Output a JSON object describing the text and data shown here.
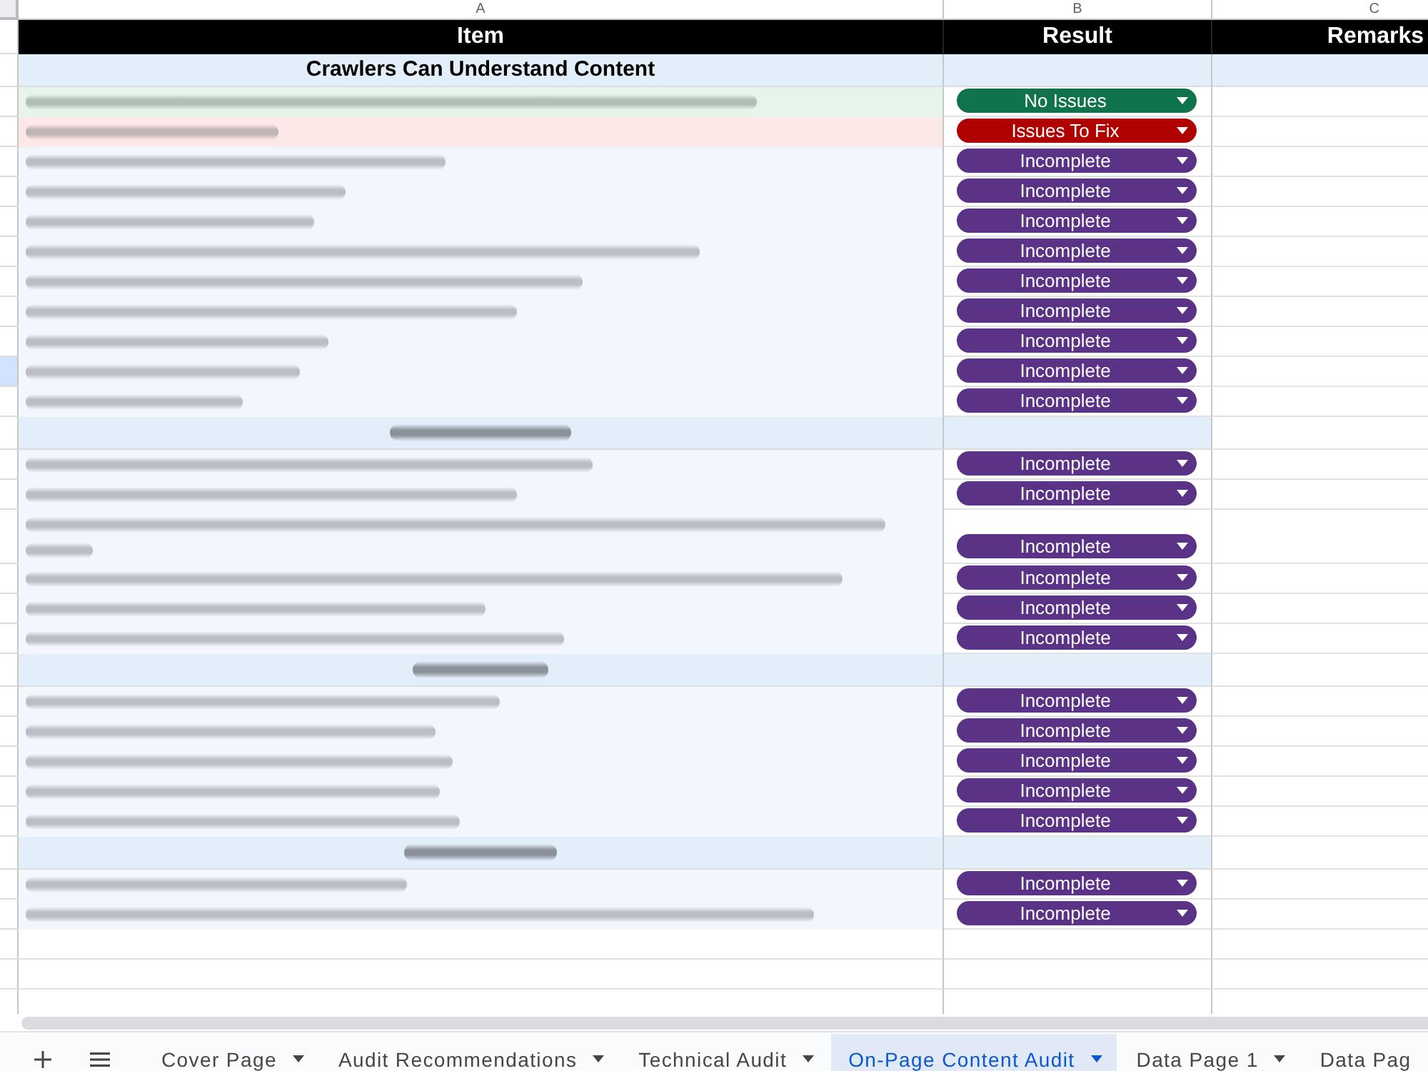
{
  "column_letters": [
    "A",
    "B",
    "C"
  ],
  "header_row": [
    "Item",
    "Result",
    "Remarks"
  ],
  "sections": [
    {
      "heading": {
        "text": "Crawlers Can Understand Content"
      },
      "remarks_shaded": true,
      "rows": [
        {
          "item": {
            "blurred": true
          },
          "color": "#e6f4ea",
          "wrapped": false,
          "selected": false,
          "result": {
            "label": "No Issues",
            "color": "#11734b"
          }
        },
        {
          "item": {
            "blurred": true
          },
          "color": "#fce8e6",
          "wrapped": false,
          "selected": false,
          "result": {
            "label": "Issues To Fix",
            "color": "#b10202"
          }
        },
        {
          "item": {
            "blurred": true
          },
          "wrapped": false,
          "selected": false,
          "result": {
            "label": "Incomplete",
            "color": "#5a3286"
          }
        },
        {
          "item": {
            "blurred": true
          },
          "wrapped": false,
          "selected": false,
          "result": {
            "label": "Incomplete",
            "color": "#5a3286"
          }
        },
        {
          "item": {
            "blurred": true
          },
          "wrapped": false,
          "selected": false,
          "result": {
            "label": "Incomplete",
            "color": "#5a3286"
          }
        },
        {
          "item": {
            "blurred": true
          },
          "wrapped": false,
          "selected": false,
          "result": {
            "label": "Incomplete",
            "color": "#5a3286"
          }
        },
        {
          "item": {
            "blurred": true
          },
          "wrapped": false,
          "selected": false,
          "result": {
            "label": "Incomplete",
            "color": "#5a3286"
          }
        },
        {
          "item": {
            "blurred": true
          },
          "wrapped": false,
          "selected": false,
          "result": {
            "label": "Incomplete",
            "color": "#5a3286"
          }
        },
        {
          "item": {
            "blurred": true
          },
          "wrapped": false,
          "selected": false,
          "result": {
            "label": "Incomplete",
            "color": "#5a3286"
          }
        },
        {
          "item": {
            "blurred": true
          },
          "wrapped": false,
          "selected": true,
          "result": {
            "label": "Incomplete",
            "color": "#5a3286"
          }
        },
        {
          "item": {
            "blurred": true
          },
          "wrapped": false,
          "selected": false,
          "result": {
            "label": "Incomplete",
            "color": "#5a3286"
          }
        }
      ]
    },
    {
      "heading": {
        "blurred": true
      },
      "remarks_shaded": false,
      "rows": [
        {
          "item": {
            "blurred": true
          },
          "wrapped": false,
          "selected": false,
          "result": {
            "label": "Incomplete",
            "color": "#5a3286"
          }
        },
        {
          "item": {
            "blurred": true
          },
          "wrapped": false,
          "selected": false,
          "result": {
            "label": "Incomplete",
            "color": "#5a3286"
          }
        },
        {
          "item": {
            "blurred": true
          },
          "wrapped": true,
          "selected": false,
          "result": {
            "label": "Incomplete",
            "color": "#5a3286"
          }
        },
        {
          "item": {
            "blurred": true
          },
          "wrapped": false,
          "selected": false,
          "result": {
            "label": "Incomplete",
            "color": "#5a3286"
          }
        },
        {
          "item": {
            "blurred": true
          },
          "wrapped": false,
          "selected": false,
          "result": {
            "label": "Incomplete",
            "color": "#5a3286"
          }
        },
        {
          "item": {
            "blurred": true
          },
          "wrapped": false,
          "selected": false,
          "result": {
            "label": "Incomplete",
            "color": "#5a3286"
          }
        }
      ]
    },
    {
      "heading": {
        "blurred": true
      },
      "remarks_shaded": false,
      "rows": [
        {
          "item": {
            "blurred": true
          },
          "wrapped": false,
          "selected": false,
          "result": {
            "label": "Incomplete",
            "color": "#5a3286"
          }
        },
        {
          "item": {
            "blurred": true
          },
          "wrapped": false,
          "selected": false,
          "result": {
            "label": "Incomplete",
            "color": "#5a3286"
          }
        },
        {
          "item": {
            "blurred": true
          },
          "wrapped": false,
          "selected": false,
          "result": {
            "label": "Incomplete",
            "color": "#5a3286"
          }
        },
        {
          "item": {
            "blurred": true
          },
          "wrapped": false,
          "selected": false,
          "result": {
            "label": "Incomplete",
            "color": "#5a3286"
          }
        },
        {
          "item": {
            "blurred": true
          },
          "wrapped": false,
          "selected": false,
          "result": {
            "label": "Incomplete",
            "color": "#5a3286"
          }
        }
      ]
    },
    {
      "heading": {
        "blurred": true
      },
      "remarks_shaded": false,
      "rows": [
        {
          "item": {
            "blurred": true
          },
          "wrapped": false,
          "selected": false,
          "result": {
            "label": "Incomplete",
            "color": "#5a3286"
          }
        },
        {
          "item": {
            "blurred": true
          },
          "wrapped": false,
          "selected": false,
          "result": {
            "label": "Incomplete",
            "color": "#5a3286"
          }
        }
      ]
    }
  ],
  "tabs": [
    {
      "label": "Cover Page",
      "selected": false,
      "menu": true
    },
    {
      "label": "Audit Recommendations",
      "selected": false,
      "menu": true
    },
    {
      "label": "Technical Audit",
      "selected": false,
      "menu": true
    },
    {
      "label": "On-Page Content Audit",
      "selected": true,
      "menu": true
    },
    {
      "label": "Data Page 1",
      "selected": false,
      "menu": true
    },
    {
      "label": "Data Pag",
      "selected": false,
      "menu": false
    }
  ]
}
